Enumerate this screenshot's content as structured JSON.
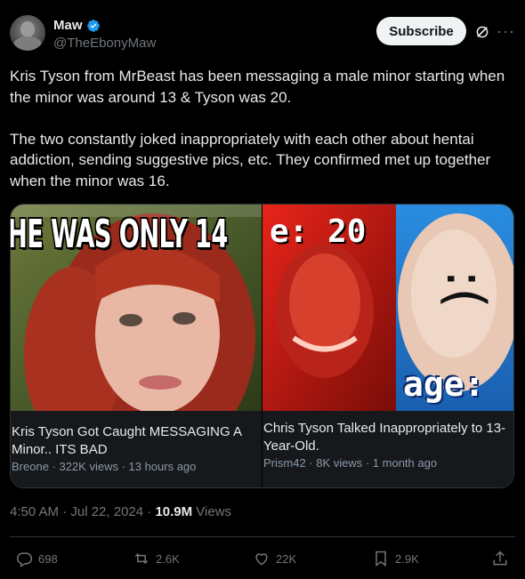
{
  "author": {
    "name": "Maw",
    "handle": "@TheEbonyMaw",
    "verified": true
  },
  "header": {
    "subscribe_label": "Subscribe",
    "icons": [
      "verified-badge-icon",
      "grok-icon",
      "more-icon"
    ]
  },
  "tweet": {
    "text": "Kris Tyson from MrBeast has been messaging a male minor starting when the minor was around 13 & Tyson was 20.\n\nThe two constantly joked inappropriately with each other about hentai addiction, sending suggestive pics, etc. They confirmed met up together when the minor was 16."
  },
  "cards": [
    {
      "thumb_text": "HE WAS ONLY 14",
      "title": "Kris Tyson Got Caught MESSAGING A Minor.. ITS BAD",
      "meta": "Breone · 322K views · 13 hours ago"
    },
    {
      "thumb_text_top": "e: 20",
      "thumb_text_bottom": "age:",
      "thumb_face": ":(",
      "title": "Chris Tyson Talked Inappropriately to 13-Year-Old.",
      "meta": "Prism42 · 8K views · 1 month ago"
    }
  ],
  "stats": {
    "time": "4:50 AM · Jul 22, 2024 · ",
    "views_count": "10.9M",
    "views_label": " Views"
  },
  "actions": {
    "replies": "698",
    "reposts": "2.6K",
    "likes": "22K",
    "bookmarks": "2.9K"
  },
  "colors": {
    "background": "#000000",
    "text": "#e7e9ea",
    "muted": "#71767b",
    "border": "#2f3336",
    "verified": "#1d9bf0"
  }
}
